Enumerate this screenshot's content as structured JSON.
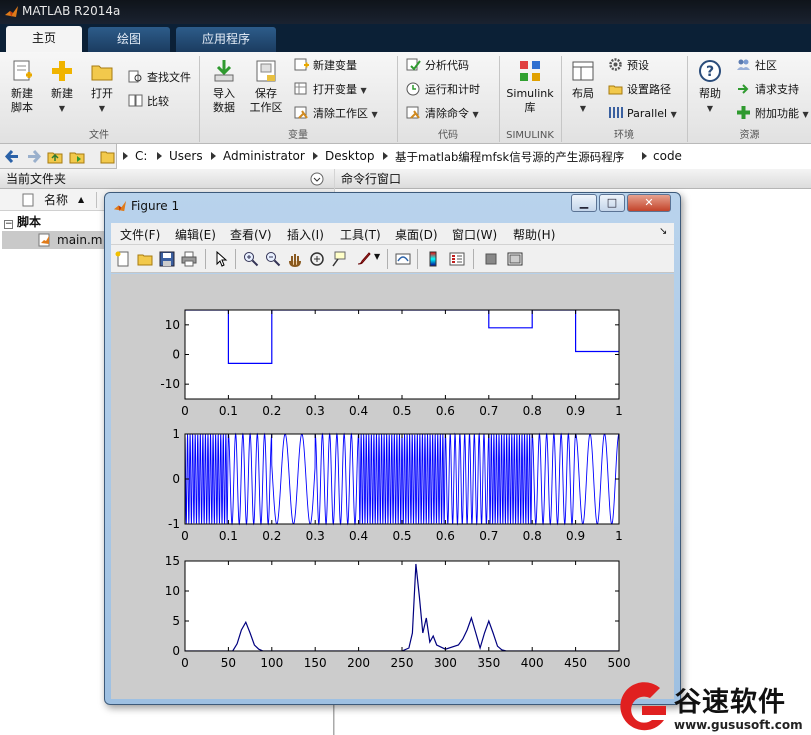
{
  "app": {
    "title": "MATLAB R2014a",
    "accent": "#0b2036"
  },
  "ribbon_tabs": [
    {
      "label": "主页"
    },
    {
      "label": "绘图"
    },
    {
      "label": "应用程序"
    }
  ],
  "ribbon": {
    "file": {
      "new_script": "新建\n脚本",
      "new": "新建",
      "open": "打开",
      "find_files": "查找文件",
      "compare": "比较",
      "group": "文件"
    },
    "variable": {
      "import_data": "导入\n数据",
      "save_workspace": "保存\n工作区",
      "new_variable": "新建变量",
      "open_variable": "打开变量",
      "clear_workspace": "清除工作区",
      "group": "变量"
    },
    "code": {
      "analyze_code": "分析代码",
      "run_and_time": "运行和计时",
      "clear_commands": "清除命令",
      "group": "代码"
    },
    "simulink": {
      "library": "Simulink\n库",
      "group": "SIMULINK"
    },
    "environment": {
      "layout": "布局",
      "preferences": "预设",
      "set_path": "设置路径",
      "parallel": "Parallel",
      "group": "环境"
    },
    "resources": {
      "help": "帮助",
      "community": "社区",
      "request_support": "请求支持",
      "add_ons": "附加功能",
      "group": "资源"
    }
  },
  "address_bar": {
    "crumbs": [
      "C:",
      "Users",
      "Administrator",
      "Desktop",
      "基于matlab编程mfsk信号源的产生源码程序",
      "code"
    ]
  },
  "current_folder": {
    "title": "当前文件夹",
    "column_name": "名称",
    "sort_arrow": "▲",
    "group": "脚本",
    "files": [
      {
        "name": "main.m"
      }
    ]
  },
  "command_window": {
    "title": "命令行窗口"
  },
  "figure": {
    "title": "Figure 1",
    "menu": [
      "文件(F)",
      "编辑(E)",
      "查看(V)",
      "插入(I)",
      "工具(T)",
      "桌面(D)",
      "窗口(W)",
      "帮助(H)"
    ],
    "toolbar_icons": [
      "new-figure-icon",
      "open-file-icon",
      "save-icon",
      "print-icon",
      "pointer-icon",
      "zoom-in-icon",
      "zoom-out-icon",
      "pan-icon",
      "rotate-3d-icon",
      "data-cursor-icon",
      "brush-icon",
      "link-plot-icon",
      "colorbar-icon",
      "legend-icon",
      "hide-plot-tools-icon",
      "show-plot-tools-icon"
    ]
  },
  "chart_data": [
    {
      "type": "line",
      "title": "",
      "xlabel": "",
      "ylabel": "",
      "xlim": [
        0,
        1
      ],
      "ylim": [
        -15,
        15
      ],
      "xticks": [
        0,
        0.1,
        0.2,
        0.3,
        0.4,
        0.5,
        0.6,
        0.7,
        0.8,
        0.9,
        1
      ],
      "yticks": [
        -10,
        0,
        10
      ],
      "series": [
        {
          "color": "#0000ff",
          "x": [
            0,
            0.1,
            0.1,
            0.2,
            0.2,
            0.7,
            0.7,
            0.8,
            0.8,
            0.9,
            0.9,
            1
          ],
          "y": [
            15,
            15,
            -3,
            -3,
            15,
            15,
            9,
            9,
            15,
            15,
            1,
            1
          ]
        }
      ]
    },
    {
      "type": "line",
      "title": "",
      "xlabel": "",
      "ylabel": "",
      "xlim": [
        0,
        1
      ],
      "ylim": [
        -1,
        1
      ],
      "xticks": [
        0,
        0.1,
        0.2,
        0.3,
        0.4,
        0.5,
        0.6,
        0.7,
        0.8,
        0.9,
        1
      ],
      "yticks": [
        -1,
        0,
        1
      ],
      "series": [
        {
          "color": "#0000ff",
          "description": "frequency-shift keyed sinusoid, amplitude 1"
        }
      ]
    },
    {
      "type": "line",
      "title": "",
      "xlabel": "",
      "ylabel": "",
      "xlim": [
        0,
        500
      ],
      "ylim": [
        0,
        15
      ],
      "xticks": [
        0,
        50,
        100,
        150,
        200,
        250,
        300,
        350,
        400,
        450,
        500
      ],
      "yticks": [
        0,
        5,
        10,
        15
      ],
      "series": [
        {
          "color": "#00007f",
          "x": [
            0,
            55,
            60,
            65,
            70,
            75,
            80,
            85,
            90,
            100,
            150,
            200,
            250,
            258,
            262,
            266,
            270,
            274,
            278,
            282,
            286,
            290,
            300,
            315,
            320,
            325,
            330,
            335,
            340,
            345,
            350,
            355,
            360,
            365,
            370,
            380,
            400,
            450,
            500
          ],
          "y": [
            0,
            0,
            1.2,
            3.5,
            4.8,
            3,
            1,
            0.3,
            0,
            0,
            0,
            0,
            0,
            0.5,
            3,
            14.5,
            9,
            3,
            5.5,
            1.5,
            2.5,
            1,
            0.3,
            1,
            2,
            3.5,
            5.5,
            3,
            0.5,
            3,
            5,
            3,
            0.8,
            0.2,
            0,
            0,
            0,
            0,
            0
          ]
        }
      ]
    }
  ],
  "watermark": {
    "brand": "谷速软件",
    "url": "www.gususoft.com",
    "color": "#e02020"
  }
}
